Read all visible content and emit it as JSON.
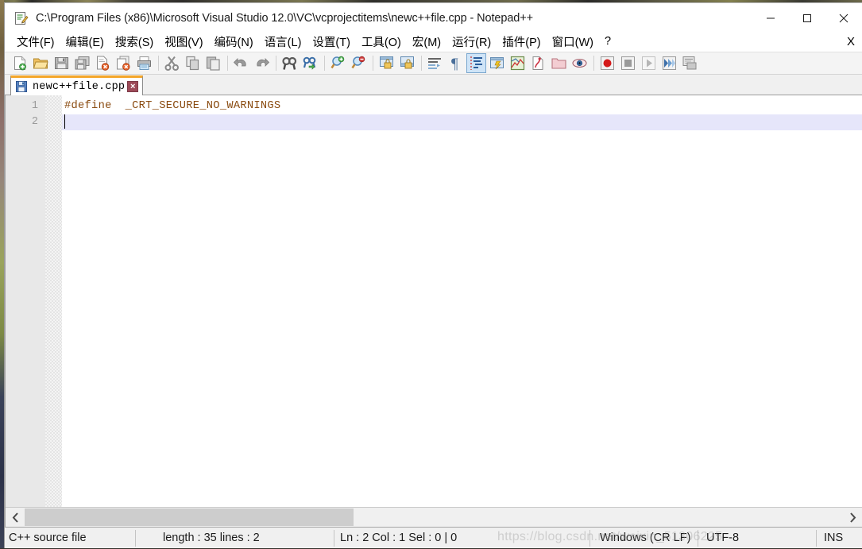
{
  "window": {
    "title": "C:\\Program Files (x86)\\Microsoft Visual Studio 12.0\\VC\\vcprojectitems\\newc++file.cpp - Notepad++",
    "app_name": "Notepad++",
    "icon": "notepad-plus-plus-icon",
    "controls": {
      "minimize": "minimize-icon",
      "maximize": "maximize-icon",
      "close": "close-icon"
    }
  },
  "menubar": {
    "items": [
      {
        "label": "文件(F)",
        "name": "menu-file"
      },
      {
        "label": "编辑(E)",
        "name": "menu-edit"
      },
      {
        "label": "搜索(S)",
        "name": "menu-search"
      },
      {
        "label": "视图(V)",
        "name": "menu-view"
      },
      {
        "label": "编码(N)",
        "name": "menu-encoding"
      },
      {
        "label": "语言(L)",
        "name": "menu-language"
      },
      {
        "label": "设置(T)",
        "name": "menu-settings"
      },
      {
        "label": "工具(O)",
        "name": "menu-tools"
      },
      {
        "label": "宏(M)",
        "name": "menu-macro"
      },
      {
        "label": "运行(R)",
        "name": "menu-run"
      },
      {
        "label": "插件(P)",
        "name": "menu-plugins"
      },
      {
        "label": "窗口(W)",
        "name": "menu-window"
      },
      {
        "label": "?",
        "name": "menu-help"
      }
    ],
    "close_doc_label": "X"
  },
  "toolbar": {
    "buttons": [
      {
        "name": "new-file-icon",
        "group": 0
      },
      {
        "name": "open-file-icon",
        "group": 0
      },
      {
        "name": "save-icon",
        "group": 0
      },
      {
        "name": "save-all-icon",
        "group": 0
      },
      {
        "name": "close-file-icon",
        "group": 0
      },
      {
        "name": "close-all-files-icon",
        "group": 0
      },
      {
        "name": "print-icon",
        "group": 0
      },
      {
        "name": "cut-icon",
        "group": 1
      },
      {
        "name": "copy-icon",
        "group": 1
      },
      {
        "name": "paste-icon",
        "group": 1
      },
      {
        "name": "undo-icon",
        "group": 2
      },
      {
        "name": "redo-icon",
        "group": 2
      },
      {
        "name": "find-icon",
        "group": 3
      },
      {
        "name": "replace-icon",
        "group": 3
      },
      {
        "name": "zoom-in-icon",
        "group": 4
      },
      {
        "name": "zoom-out-icon",
        "group": 4
      },
      {
        "name": "sync-vertical-scroll-icon",
        "group": 5
      },
      {
        "name": "sync-horizontal-scroll-icon",
        "group": 5
      },
      {
        "name": "word-wrap-icon",
        "group": 6
      },
      {
        "name": "show-all-characters-icon",
        "group": 6
      },
      {
        "name": "indent-guide-icon",
        "group": 6,
        "active": true
      },
      {
        "name": "user-defined-language-icon",
        "group": 6
      },
      {
        "name": "document-map-icon",
        "group": 6
      },
      {
        "name": "function-list-icon",
        "group": 6
      },
      {
        "name": "folder-as-workspace-icon",
        "group": 6
      },
      {
        "name": "document-monitoring-icon",
        "group": 6
      },
      {
        "name": "macro-record-icon",
        "group": 7
      },
      {
        "name": "macro-stop-icon",
        "group": 7
      },
      {
        "name": "macro-playback-icon",
        "group": 7
      },
      {
        "name": "macro-run-multiple-icon",
        "group": 7
      },
      {
        "name": "macro-save-icon",
        "group": 7
      }
    ]
  },
  "tabs": [
    {
      "label": "newc++file.cpp",
      "icon": "saved-file-icon",
      "close_label": "×",
      "active": true
    }
  ],
  "editor": {
    "line_numbers": [
      "1",
      "2"
    ],
    "lines": [
      {
        "text": "#define  _CRT_SECURE_NO_WARNINGS",
        "current": false
      },
      {
        "text": "",
        "current": true
      }
    ],
    "syntax_color": "#8a4b10",
    "current_line_color": "#e6e6fa"
  },
  "hscroll": {
    "left_arrow": "‹",
    "right_arrow": "›"
  },
  "statusbar": {
    "file_type": "C++ source file",
    "length_lines": "length : 35    lines : 2",
    "position": "Ln : 2    Col : 1    Sel : 0 | 0",
    "eol": "Windows (CR LF)",
    "encoding": "UTF-8",
    "insert_mode": "INS",
    "watermark": "https://blog.csdn.net/weixin_51306225"
  }
}
